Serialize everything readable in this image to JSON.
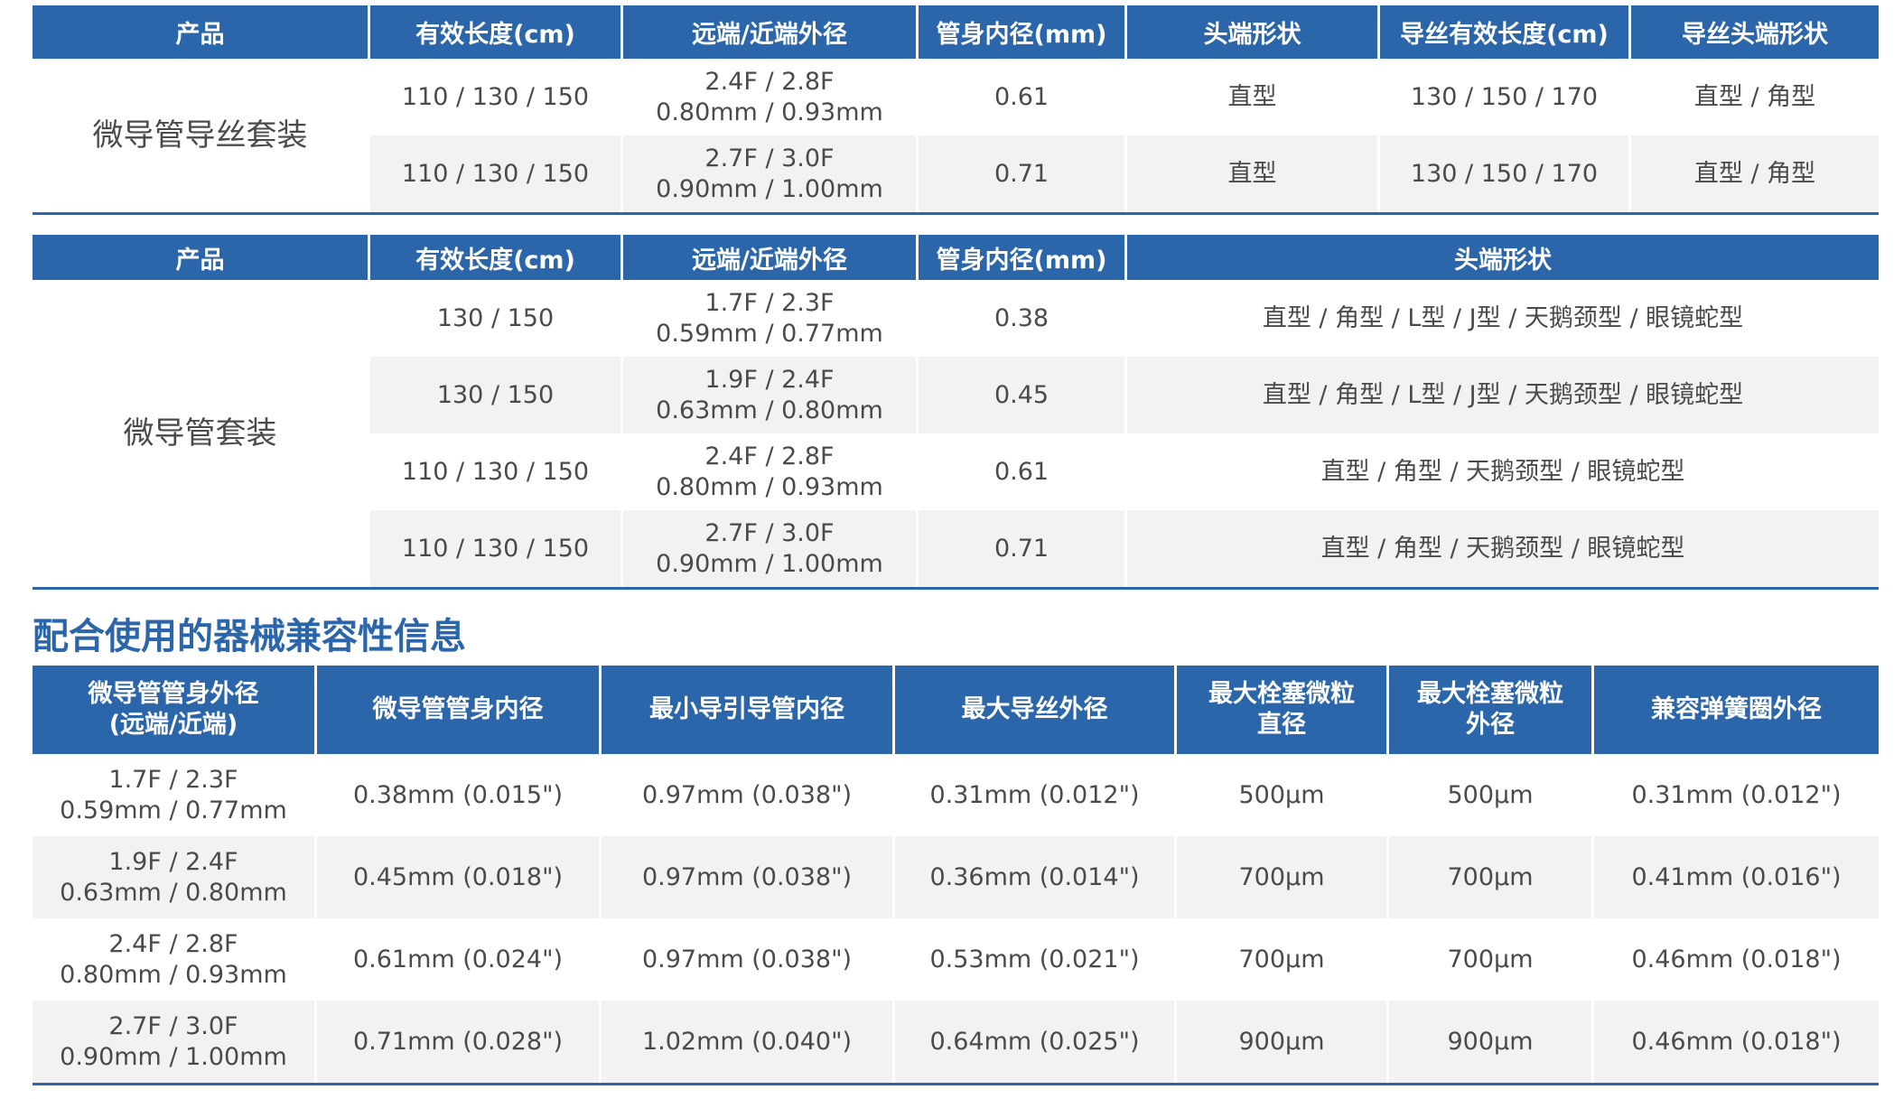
{
  "table1": {
    "headers": [
      "产品",
      "有效长度(cm)",
      "远端/近端外径",
      "管身内径(mm)",
      "头端形状",
      "导丝有效长度(cm)",
      "导丝头端形状"
    ],
    "product": "微导管导丝套装",
    "rows": [
      {
        "length": "110 / 130 / 150",
        "od_line1": "2.4F / 2.8F",
        "od_line2": "0.80mm / 0.93mm",
        "id": "0.61",
        "tip": "直型",
        "gw_length": "130 / 150 / 170",
        "gw_tip": "直型 / 角型"
      },
      {
        "length": "110 / 130 / 150",
        "od_line1": "2.7F / 3.0F",
        "od_line2": "0.90mm / 1.00mm",
        "id": "0.71",
        "tip": "直型",
        "gw_length": "130 / 150 / 170",
        "gw_tip": "直型 / 角型"
      }
    ]
  },
  "table2": {
    "headers": [
      "产品",
      "有效长度(cm)",
      "远端/近端外径",
      "管身内径(mm)",
      "头端形状"
    ],
    "product": "微导管套装",
    "rows": [
      {
        "length": "130 / 150",
        "od_line1": "1.7F / 2.3F",
        "od_line2": "0.59mm / 0.77mm",
        "id": "0.38",
        "tip": "直型 / 角型 / L型 / J型 / 天鹅颈型 / 眼镜蛇型"
      },
      {
        "length": "130 / 150",
        "od_line1": "1.9F / 2.4F",
        "od_line2": "0.63mm / 0.80mm",
        "id": "0.45",
        "tip": "直型 / 角型 / L型 / J型 / 天鹅颈型 / 眼镜蛇型"
      },
      {
        "length": "110 / 130 / 150",
        "od_line1": "2.4F / 2.8F",
        "od_line2": "0.80mm / 0.93mm",
        "id": "0.61",
        "tip": "直型 / 角型 /  天鹅颈型 / 眼镜蛇型"
      },
      {
        "length": "110 / 130 / 150",
        "od_line1": "2.7F / 3.0F",
        "od_line2": "0.90mm / 1.00mm",
        "id": "0.71",
        "tip": "直型 / 角型 / 天鹅颈型 / 眼镜蛇型"
      }
    ]
  },
  "compat": {
    "title": "配合使用的器械兼容性信息",
    "headers": [
      {
        "line1": "微导管管身外径",
        "line2": "(远端/近端)"
      },
      {
        "line1": "微导管管身内径",
        "line2": ""
      },
      {
        "line1": "最小导引导管内径",
        "line2": ""
      },
      {
        "line1": "最大导丝外径",
        "line2": ""
      },
      {
        "line1": "最大栓塞微粒",
        "line2": "直径"
      },
      {
        "line1": "最大栓塞微粒",
        "line2": "外径"
      },
      {
        "line1": "兼容弹簧圈外径",
        "line2": ""
      }
    ],
    "rows": [
      {
        "od_line1": "1.7F / 2.3F",
        "od_line2": "0.59mm / 0.77mm",
        "inner": "0.38mm (0.015\")",
        "guide": "0.97mm (0.038\")",
        "wire": "0.31mm (0.012\")",
        "particle_d": "500µm",
        "particle_od": "500µm",
        "coil": "0.31mm (0.012\")"
      },
      {
        "od_line1": "1.9F / 2.4F",
        "od_line2": "0.63mm / 0.80mm",
        "inner": "0.45mm (0.018\")",
        "guide": "0.97mm (0.038\")",
        "wire": "0.36mm (0.014\")",
        "particle_d": "700µm",
        "particle_od": "700µm",
        "coil": "0.41mm (0.016\")"
      },
      {
        "od_line1": "2.4F / 2.8F",
        "od_line2": "0.80mm / 0.93mm",
        "inner": "0.61mm (0.024\")",
        "guide": "0.97mm (0.038\")",
        "wire": "0.53mm (0.021\")",
        "particle_d": "700µm",
        "particle_od": "700µm",
        "coil": "0.46mm (0.018\")"
      },
      {
        "od_line1": "2.7F / 3.0F",
        "od_line2": "0.90mm / 1.00mm",
        "inner": "0.71mm (0.028\")",
        "guide": "1.02mm (0.040\")",
        "wire": "0.64mm (0.025\")",
        "particle_d": "900µm",
        "particle_od": "900µm",
        "coil": "0.46mm (0.018\")"
      }
    ]
  },
  "colors": {
    "header_bg": "#2c66aa",
    "stripe_bg": "#f2f2f2",
    "text": "#4a4a4a"
  }
}
